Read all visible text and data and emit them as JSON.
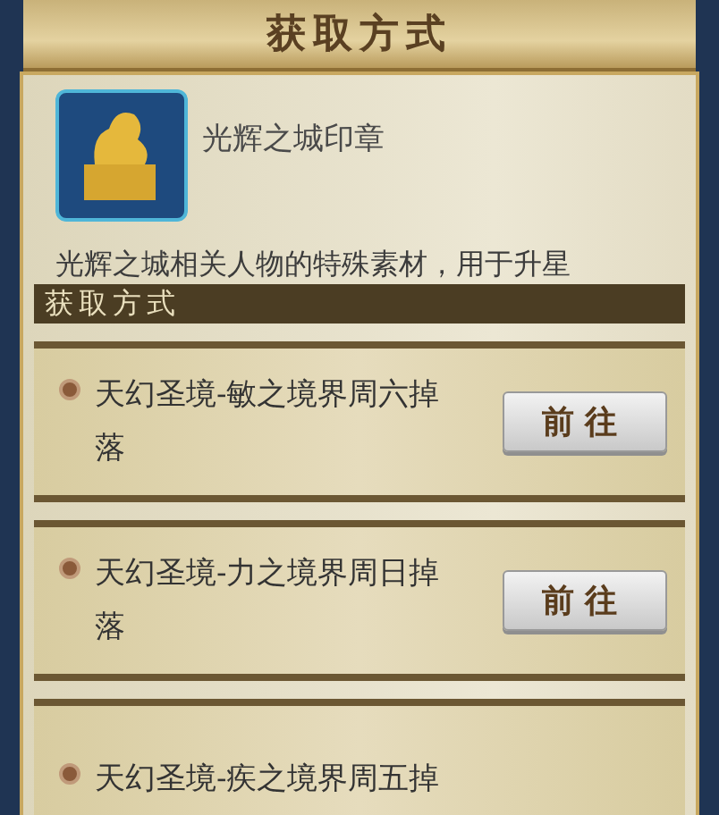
{
  "window": {
    "title": "获取方式"
  },
  "item": {
    "name": "光辉之城印章",
    "description": "光辉之城相关人物的特殊素材，用于升星"
  },
  "section": {
    "title": "获取方式"
  },
  "sources": [
    {
      "text": "天幻圣境-敏之境界周六掉落",
      "button": "前往"
    },
    {
      "text": "天幻圣境-力之境界周日掉落",
      "button": "前往"
    },
    {
      "text": "天幻圣境-疾之境界周五掉"
    }
  ]
}
